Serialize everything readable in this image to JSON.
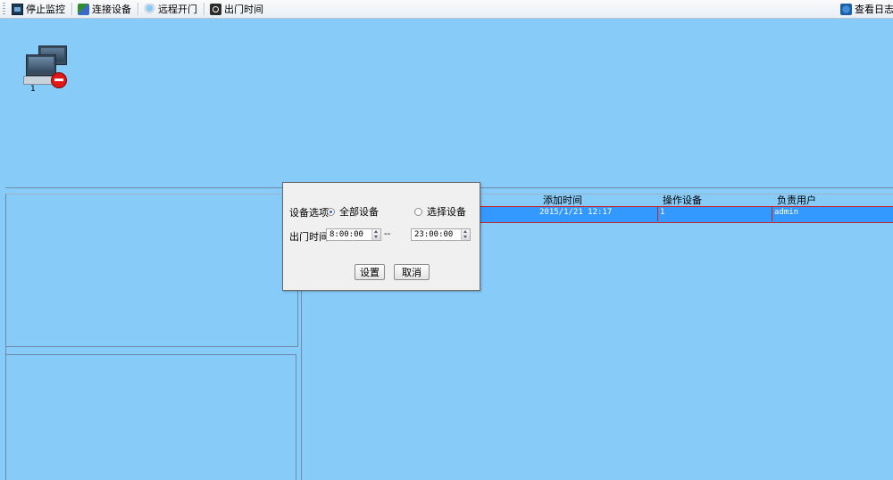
{
  "toolbar": {
    "items": [
      {
        "label": "停止监控",
        "icon": "monitor-stop-icon"
      },
      {
        "label": "连接设备",
        "icon": "connect-device-icon"
      },
      {
        "label": "远程开门",
        "icon": "remote-door-icon"
      },
      {
        "label": "出门时间",
        "icon": "clock-icon"
      }
    ],
    "right_label": "查看日志",
    "right_icon": "log-icon"
  },
  "device_panel": {
    "devices": [
      {
        "number": "1",
        "status": "disconnected"
      }
    ]
  },
  "table": {
    "headers": [
      "添加时间",
      "操作设备",
      "负责用户"
    ],
    "rows": [
      {
        "time": "2015/1/21 12:17",
        "device": "1",
        "user": "admin",
        "selected": true
      }
    ]
  },
  "dialog": {
    "device_option_label": "设备选项",
    "radio_all_label": "全部设备",
    "radio_select_label": "选择设备",
    "selected_option": "全部设备",
    "exit_time_label": "出门时间",
    "time_start": "8:00:00",
    "time_end": "23:00:00",
    "separator": "--",
    "ok_button": "设置",
    "cancel_button": "取消"
  },
  "colors": {
    "background": "#87cbf8",
    "selected_row": "#3399ff",
    "row_border": "#cc2222"
  }
}
